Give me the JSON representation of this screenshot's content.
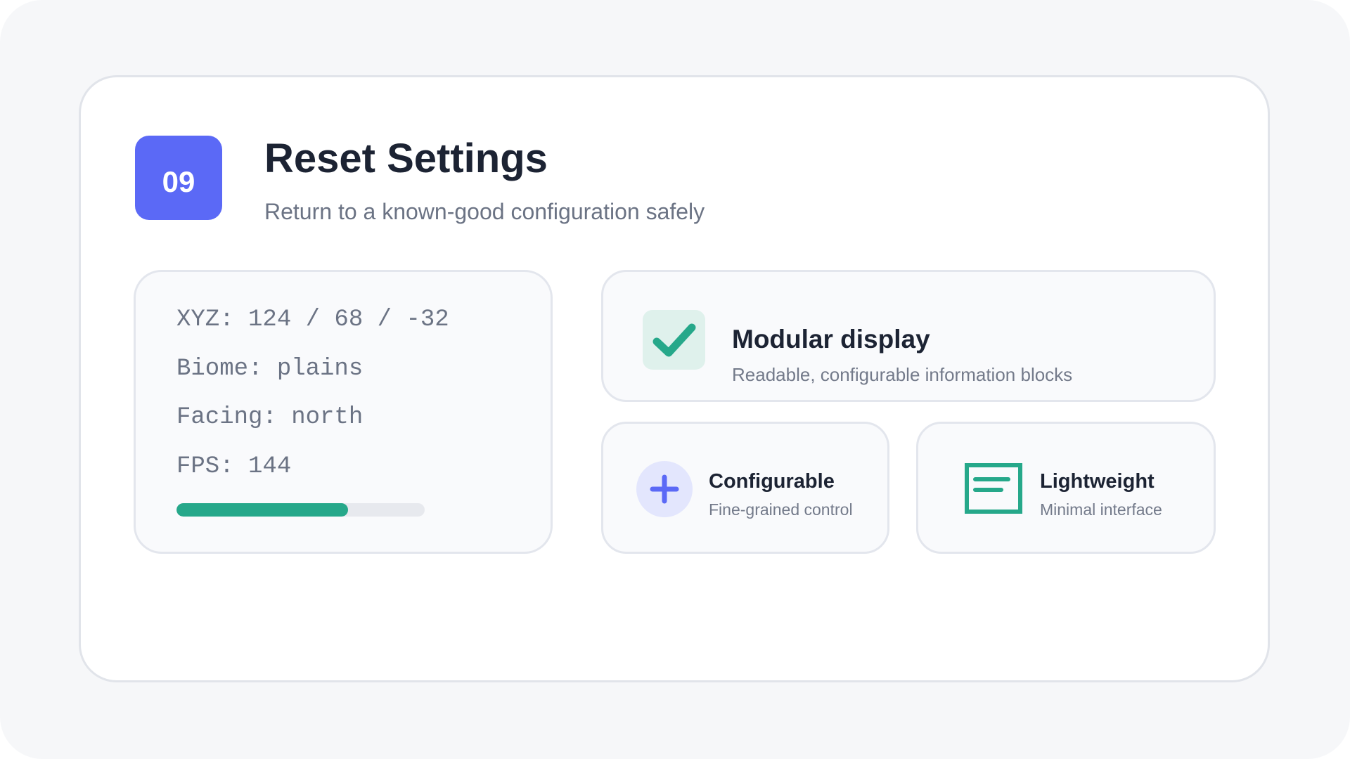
{
  "header": {
    "step_number": "09",
    "title": "Reset Settings",
    "subtitle": "Return to a known-good configuration safely"
  },
  "stats": {
    "lines": [
      "XYZ: 124 / 68 / -32",
      "Biome: plains",
      "Facing: north",
      "FPS: 144"
    ],
    "progress_fraction": 0.69
  },
  "features": {
    "modular": {
      "icon": "checkmark-icon",
      "title": "Modular display",
      "description": "Readable, configurable information blocks"
    },
    "configurable": {
      "icon": "plus-icon",
      "title": "Configurable",
      "description": "Fine-grained control"
    },
    "lightweight": {
      "icon": "document-icon",
      "title": "Lightweight",
      "description": "Minimal interface"
    }
  },
  "colors": {
    "accent_blue": "#5b69f6",
    "accent_green": "#26a88a",
    "title_text": "#1c2333",
    "muted_text": "#6b7384",
    "background": "#f6f7f9"
  }
}
